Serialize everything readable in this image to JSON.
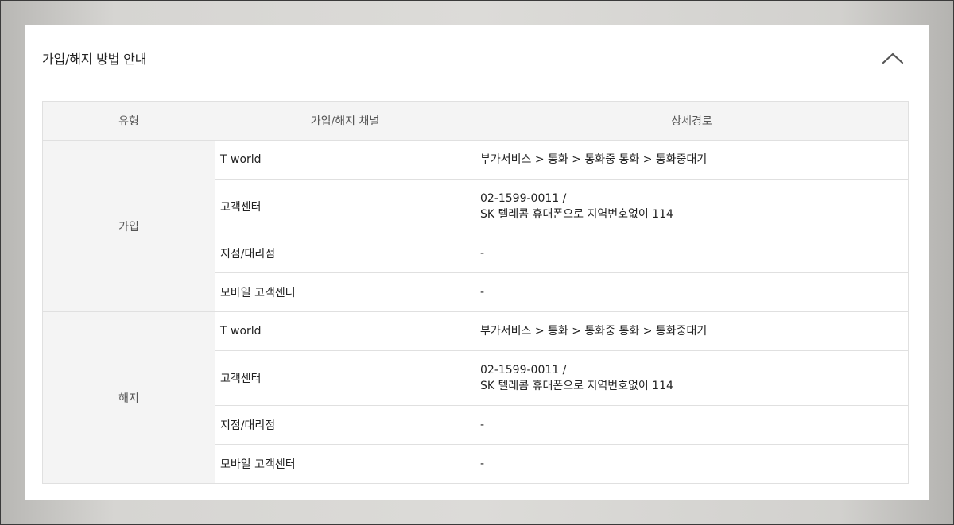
{
  "section": {
    "title": "가입/해지 방법 안내",
    "collapse_icon": "chevron-up-icon"
  },
  "table": {
    "headers": [
      "유형",
      "가입/해지 채널",
      "상세경로"
    ],
    "groups": [
      {
        "type": "가입",
        "rows": [
          {
            "channel": "T world",
            "path": [
              "부가서비스 > 통화 > 통화중 통화 > 통화중대기"
            ]
          },
          {
            "channel": "고객센터",
            "path": [
              "02-1599-0011 /",
              "SK 텔레콤 휴대폰으로 지역번호없이 114"
            ]
          },
          {
            "channel": "지점/대리점",
            "path": [
              "-"
            ]
          },
          {
            "channel": "모바일 고객센터",
            "path": [
              "-"
            ]
          }
        ]
      },
      {
        "type": "해지",
        "rows": [
          {
            "channel": "T world",
            "path": [
              "부가서비스 > 통화 > 통화중 통화 > 통화중대기"
            ]
          },
          {
            "channel": "고객센터",
            "path": [
              "02-1599-0011 /",
              "SK 텔레콤 휴대폰으로 지역번호없이 114"
            ]
          },
          {
            "channel": "지점/대리점",
            "path": [
              "-"
            ]
          },
          {
            "channel": "모바일 고객센터",
            "path": [
              "-"
            ]
          }
        ]
      }
    ]
  }
}
